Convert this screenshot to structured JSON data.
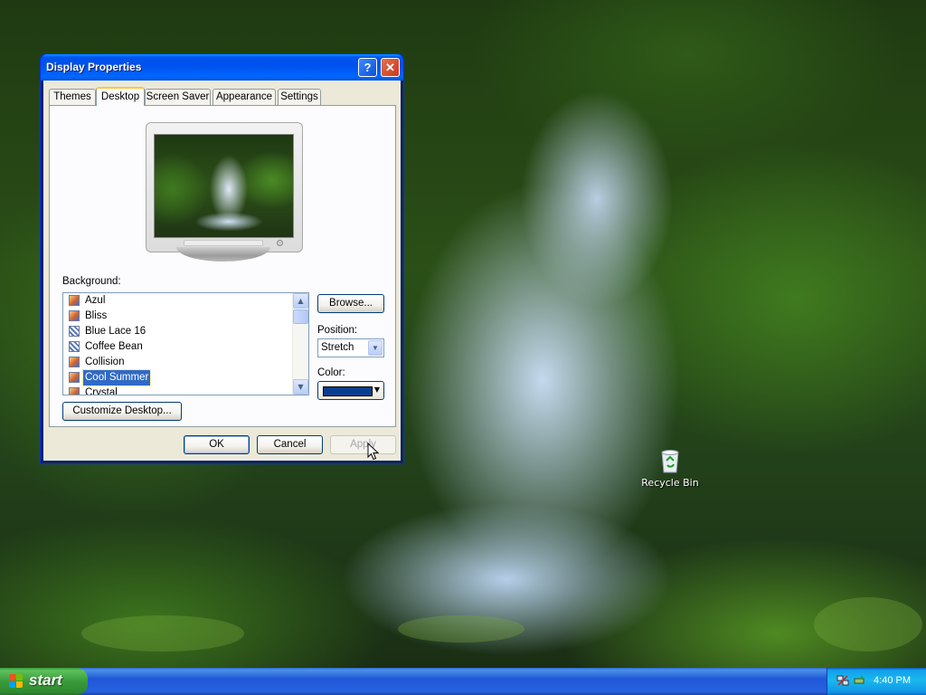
{
  "window": {
    "title": "Display Properties",
    "help_button": "?",
    "close_button": "✕"
  },
  "tabs": [
    {
      "label": "Themes",
      "active": false
    },
    {
      "label": "Desktop",
      "active": true
    },
    {
      "label": "Screen Saver",
      "active": false
    },
    {
      "label": "Appearance",
      "active": false
    },
    {
      "label": "Settings",
      "active": false
    }
  ],
  "desktop_tab": {
    "background_label": "Background:",
    "background_items": [
      {
        "label": "Azul",
        "icon": "image-file-icon",
        "selected": false
      },
      {
        "label": "Bliss",
        "icon": "image-file-icon",
        "selected": false
      },
      {
        "label": "Blue Lace 16",
        "icon": "pattern-file-icon",
        "selected": false
      },
      {
        "label": "Coffee Bean",
        "icon": "pattern-file-icon",
        "selected": false
      },
      {
        "label": "Collision",
        "icon": "image-file-icon",
        "selected": false
      },
      {
        "label": "Cool Summer",
        "icon": "image-file-icon",
        "selected": true
      },
      {
        "label": "Crystal",
        "icon": "image-file-icon",
        "selected": false
      }
    ],
    "browse_button": "Browse...",
    "position_label": "Position:",
    "position_value": "Stretch",
    "color_label": "Color:",
    "color_value": "#0a3d8f",
    "customize_button": "Customize Desktop..."
  },
  "footer": {
    "ok": "OK",
    "cancel": "Cancel",
    "apply": "Apply"
  },
  "desktop": {
    "recycle_bin_label": "Recycle Bin"
  },
  "taskbar": {
    "start_label": "start",
    "clock": "4:40 PM"
  }
}
